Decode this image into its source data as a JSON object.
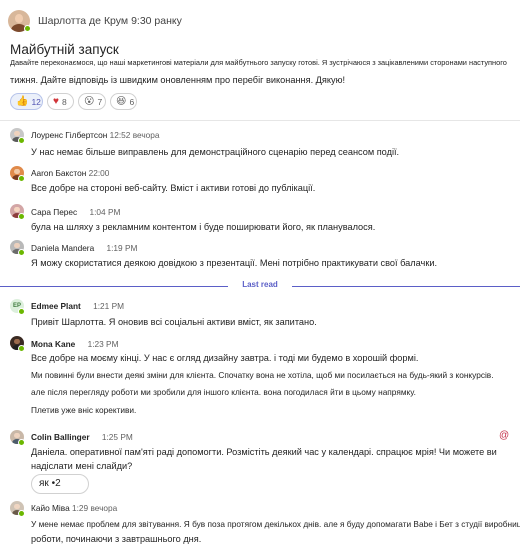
{
  "post": {
    "author": "Шарлотта де Крум",
    "time": "9:30 ранку",
    "title": "Майбутній запуск",
    "body_line1": "Давайте переконаємося, що наші маркетингові матеріали для майбутнього запуску готові. Я зустрічаюся з зацікавленими сторонами наступного",
    "body_line2": "тижня. Дайте відповідь із швидким оновленням про перебіг виконання. Дякую!",
    "reactions": [
      {
        "icon": "thumbs-up-icon",
        "glyph": "👍",
        "count": "12"
      },
      {
        "icon": "heart-icon",
        "glyph": "♥",
        "count": "8"
      },
      {
        "icon": "surprised-icon",
        "glyph": "😮",
        "count": "7"
      },
      {
        "icon": "laugh-icon",
        "glyph": "😆",
        "count": "6"
      }
    ]
  },
  "messages": [
    {
      "author": "Лоуренс Гілбертсон",
      "time": "12:52 вечора",
      "lines": [
        "У нас немає більше виправлень для демонстраційного сценарію перед сеансом події."
      ]
    },
    {
      "author": "Aaron Бакстон",
      "time": "22:00",
      "lines": [
        "Все добре на стороні веб-сайту. Вміст і активи готові до публікації."
      ]
    },
    {
      "author": "Сара Перес",
      "time": "1:04 PM",
      "lines": [
        "була на шляху з рекламним контентом і буде поширювати його, як планувалося."
      ]
    },
    {
      "author": "Daniela Mandera",
      "time": "1:19 PM",
      "lines": [
        "Я можу скористатися деякою довідкою з презентації. Мені потрібно практикувати свої балачки."
      ]
    },
    {
      "author": "Edmee Plant",
      "initials": "EP",
      "time": "1:21 PM",
      "lines": [
        "Привіт Шарлотта. Я оновив всі соціальні активи вміст, як запитано."
      ]
    },
    {
      "author": "Mona Kane",
      "time": "1:23 PM",
      "lines": [
        "Все добре на моєму кінці. У нас є огляд дизайну завтра. і тоді ми будемо в хорошій формі.",
        "Ми повинні були внести деякі зміни для клієнта. Спочатку вона не хотіла, щоб ми посилається на будь-який з конкурсів.",
        "але після перегляду роботи ми зробили для іншого клієнта. вона погодилася йти в цьому напрямку.",
        "Плетив уже вніс корективи."
      ]
    },
    {
      "author": "Colin Ballinger",
      "time": "1:25 PM",
      "lines": [
        "Даніела. оперативної пам'яті раді допомогти. Розмістіть деякий час у календарі. спрацює мрія! Чи можете ви",
        "надіслати мені слайди?"
      ],
      "mention_symbol": "@",
      "reaction_chip": "як •2"
    },
    {
      "author": "Кайо Міва",
      "time": "1:29 вечора",
      "lines": [
        "У мене немає проблем для звітування. Я був поза протягом декількох днів. але я буду допомагати Babe і Бет з студії виробництв",
        "роботи, починаючи з завтрашнього дня."
      ]
    }
  ],
  "last_read_label": "Last read",
  "colors": {
    "presence": "#6bb700",
    "accent": "#5b5fc7",
    "mention": "#c4314b"
  }
}
